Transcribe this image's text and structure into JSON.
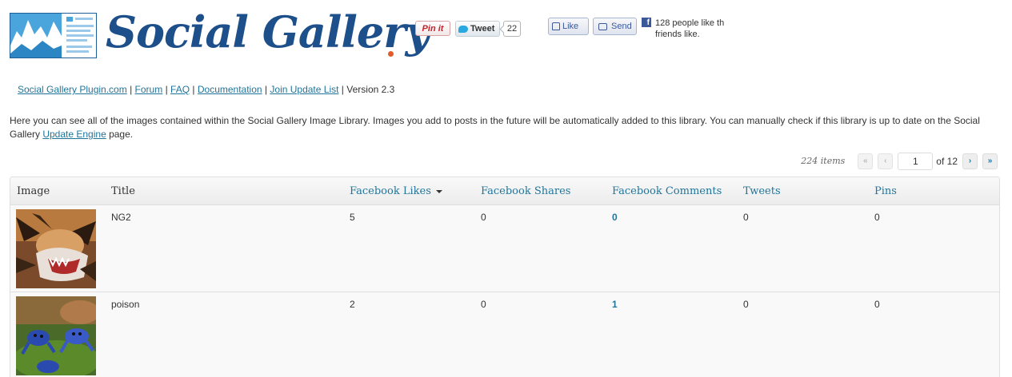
{
  "header": {
    "logo_text": "Social Gallery",
    "pin_label": "Pin it",
    "tweet_label": "Tweet",
    "tweet_count": "22",
    "like_label": "Like",
    "send_label": "Send",
    "fb_social_text": "128 people like th friends like."
  },
  "links": {
    "items": [
      "Social Gallery Plugin.com",
      "Forum",
      "FAQ",
      "Documentation",
      "Join Update List"
    ],
    "separator": "|",
    "version": "Version 2.3"
  },
  "description": {
    "text_before": "Here you can see all of the images contained within the Social Gallery Image Library. Images you add to posts in the future will be automatically added to this library. You can manually check if this library is up to date on the Social Gallery ",
    "link": "Update Engine",
    "text_after": " page."
  },
  "pagination": {
    "items_text": "224 items",
    "first": "«",
    "prev": "‹",
    "current_page": "1",
    "of_text": "of 12",
    "next": "›",
    "last": "»"
  },
  "table": {
    "columns": [
      "Image",
      "Title",
      "Facebook Likes",
      "Facebook Shares",
      "Facebook Comments",
      "Tweets",
      "Pins"
    ],
    "rows": [
      {
        "title": "NG2",
        "likes": "5",
        "shares": "0",
        "comments": "0",
        "tweets": "0",
        "pins": "0",
        "image": "tiger-photo"
      },
      {
        "title": "poison",
        "likes": "2",
        "shares": "0",
        "comments": "1",
        "tweets": "0",
        "pins": "0",
        "image": "blue-frogs-photo"
      }
    ]
  },
  "colors": {
    "link": "#21759b",
    "brand": "#1d4f8a",
    "facebook": "#3b5998"
  }
}
